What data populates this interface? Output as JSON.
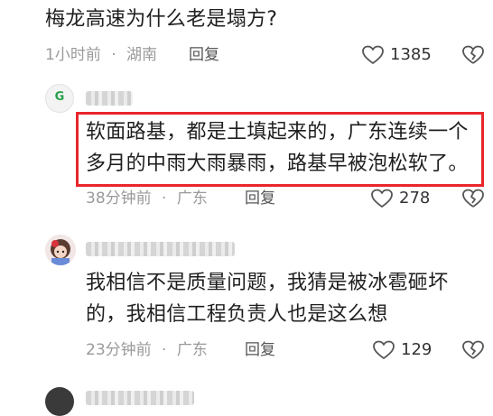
{
  "question": {
    "text": "梅龙高速为什么老是塌方?",
    "time": "1小时前",
    "dot": "·",
    "location": "湖南",
    "reply_label": "回复",
    "likes": "1385"
  },
  "comments": [
    {
      "avatar_label": "G",
      "text_line1": "软面路基，都是土填起来的，广东连续一个",
      "text_line2": "多月的中雨大雨暴雨，路基早被泡松软了。",
      "time": "38分钟前",
      "dot": "·",
      "location": "广东",
      "reply_label": "回复",
      "likes": "278"
    },
    {
      "text_line1": "我相信不是质量问题，我猜是被冰雹砸坏",
      "text_line2": "的，我相信工程负责人也是这么想",
      "time": "23分钟前",
      "dot": "·",
      "location": "广东",
      "reply_label": "回复",
      "likes": "129"
    }
  ],
  "colors": {
    "highlight_border": "#e8262b",
    "meta_text": "#9a9a9a",
    "body_text": "#1f1f1f"
  }
}
